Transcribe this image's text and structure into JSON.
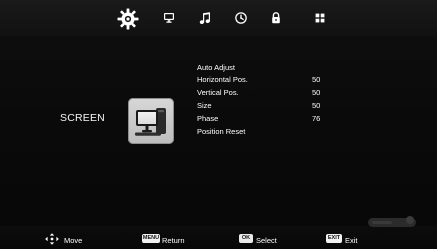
{
  "top_menu": {
    "items": [
      {
        "icon": "gear-icon",
        "state": "active"
      },
      {
        "icon": "monitor-icon",
        "state": "inactive"
      },
      {
        "icon": "music-note-icon",
        "state": "inactive"
      },
      {
        "icon": "clock-icon",
        "state": "inactive"
      },
      {
        "icon": "lock-icon",
        "state": "inactive"
      },
      {
        "icon": "grid-icon",
        "state": "inactive"
      }
    ]
  },
  "category": {
    "label": "SCREEN",
    "icon": "monitor-pc-icon"
  },
  "settings": [
    {
      "label": "Auto Adjust",
      "value": ""
    },
    {
      "label": "Horizontal Pos.",
      "value": "50"
    },
    {
      "label": "Vertical Pos.",
      "value": "50"
    },
    {
      "label": "Size",
      "value": "50"
    },
    {
      "label": "Phase",
      "value": "76"
    },
    {
      "label": "Position Reset",
      "value": ""
    }
  ],
  "footer": {
    "move": {
      "label": "Move",
      "icon": "dpad-icon"
    },
    "return": {
      "key": "MENU",
      "label": "Return"
    },
    "select": {
      "key": "OK",
      "label": "Select"
    },
    "exit": {
      "key": "EXIT",
      "label": "Exit"
    }
  },
  "colors": {
    "background": "#0b0b0b",
    "text": "#ffffff",
    "key_background": "#f2f2f2",
    "tile_background": "#cfcfcf"
  }
}
